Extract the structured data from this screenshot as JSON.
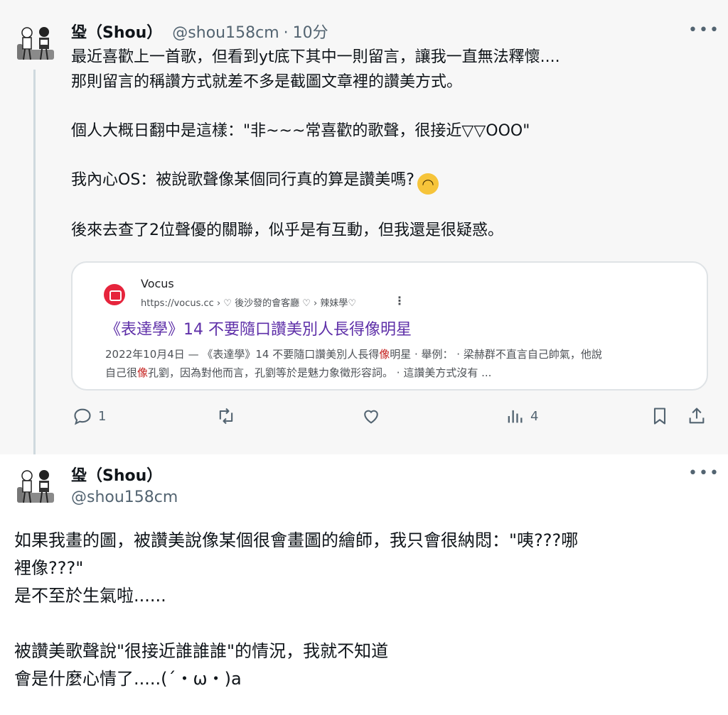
{
  "post1": {
    "author": {
      "name": "㺸（Shou）",
      "handle": "@shou158cm",
      "separator": "·",
      "time": "10分"
    },
    "more": "•••",
    "lines": [
      "最近喜歡上一首歌，但看到yt底下其中一則留言，讓我一直無法釋懷....",
      "那則留言的稱讚方式就差不多是截圖文章裡的讚美方式。",
      "",
      "個人大概日翻中是這樣：\"非~~~常喜歡的歌聲，很接近▽▽OOO\"",
      "",
      "我內心OS：被說歌聲像某個同行真的算是讚美嗎?",
      "",
      "後來去查了2位聲優的關聯，似乎是有互動，但我還是很疑惑。"
    ],
    "emoji": "upside-down-face",
    "emoji_glyph": "◠",
    "card": {
      "site": "Vocus",
      "url": "https://vocus.cc › ♡ 後沙發的會客廳 ♡ › 辣妹學♡",
      "kebab": "⋮",
      "title": "《表達學》14 不要隨口讚美別人長得像明星",
      "snippet_1a": "2022年10月4日 — 《表達學》14 不要隨口讚美別人長得",
      "snippet_1hl": "像",
      "snippet_1b": "明星 · 舉例： · 梁赫群不直言自己帥氣，他說",
      "snippet_2a": "自己很",
      "snippet_2hl": "像",
      "snippet_2b": "孔劉，因為對他而言，孔劉等於是魅力象徵形容詞。 · 這讚美方式沒有 ..."
    },
    "actions": {
      "reply_count": "1",
      "views_count": "4"
    }
  },
  "post2": {
    "author": {
      "name": "㺸（Shou）",
      "handle": "@shou158cm"
    },
    "more": "•••",
    "lines": [
      "如果我畫的圖，被讚美說像某個很會畫圖的繪師，我只會很納悶：\"咦???哪",
      "裡像???\"",
      "是不至於生氣啦......",
      "",
      "被讚美歌聲說\"很接近誰誰誰\"的情況，我就不知道",
      "會是什麼心情了.....(´・ω・)a"
    ]
  },
  "colors": {
    "text": "#0f1419",
    "muted": "#536471",
    "link_title": "#5e2fa8",
    "highlight": "#c5221f",
    "brand_logo": "#e6243c",
    "thread_line": "#cfd9de"
  }
}
